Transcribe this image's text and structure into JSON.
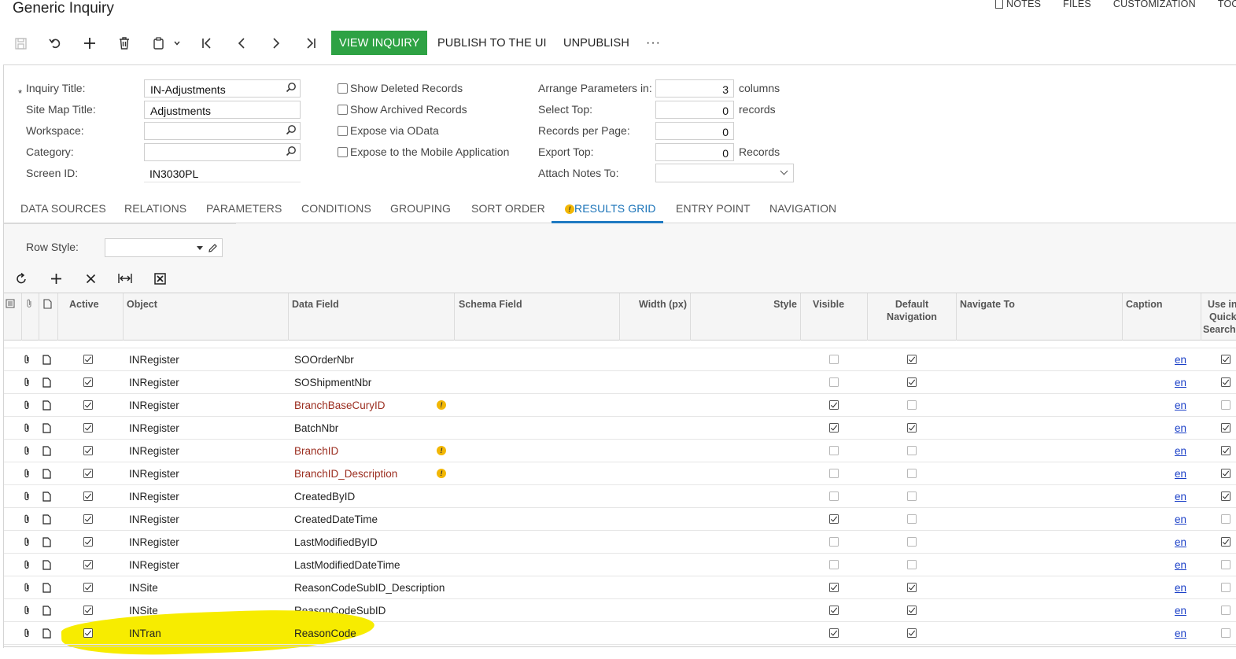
{
  "page": {
    "title": "Generic Inquiry"
  },
  "top_links": {
    "notes": "NOTES",
    "files": "FILES",
    "customization": "CUSTOMIZATION",
    "tools": "TOOLS"
  },
  "toolbar": {
    "view_inquiry": "VIEW INQUIRY",
    "publish": "PUBLISH TO THE UI",
    "unpublish": "UNPUBLISH",
    "more": "···",
    "accent_color": "#2ea244"
  },
  "form": {
    "inquiry_title_label": "Inquiry Title:",
    "inquiry_title_value": "IN-Adjustments",
    "site_map_title_label": "Site Map Title:",
    "site_map_title_value": "Adjustments",
    "workspace_label": "Workspace:",
    "workspace_value": "",
    "category_label": "Category:",
    "category_value": "",
    "screen_id_label": "Screen ID:",
    "screen_id_value": "IN3030PL",
    "show_deleted": "Show Deleted Records",
    "show_archived": "Show Archived Records",
    "expose_odata": "Expose via OData",
    "expose_mobile": "Expose to the Mobile Application",
    "arrange_label": "Arrange Parameters in:",
    "arrange_value": "3",
    "arrange_unit": "columns",
    "select_top_label": "Select Top:",
    "select_top_value": "0",
    "select_top_unit": "records",
    "records_per_page_label": "Records per Page:",
    "records_per_page_value": "0",
    "export_top_label": "Export Top:",
    "export_top_value": "0",
    "export_top_unit": "Records",
    "attach_notes_label": "Attach Notes To:",
    "attach_notes_value": ""
  },
  "tabs": [
    "DATA SOURCES",
    "RELATIONS",
    "PARAMETERS",
    "CONDITIONS",
    "GROUPING",
    "SORT ORDER",
    "RESULTS GRID",
    "ENTRY POINT",
    "NAVIGATION"
  ],
  "active_tab": "RESULTS GRID",
  "row_style": {
    "label": "Row Style:",
    "value": ""
  },
  "grid": {
    "columns": {
      "active": "Active",
      "object": "Object",
      "data_field": "Data Field",
      "schema_field": "Schema Field",
      "width": "Width (px)",
      "style": "Style",
      "visible": "Visible",
      "default_nav_1": "Default",
      "default_nav_2": "Navigation",
      "navigate_to": "Navigate To",
      "caption": "Caption",
      "quick_1": "Use in",
      "quick_2": "Quick",
      "quick_3": "Search"
    },
    "rows": [
      {
        "object": "INRegister",
        "field": "SOOrderNbr",
        "warn": false,
        "visible": false,
        "defnav": true,
        "caption": "en",
        "quick": true
      },
      {
        "object": "INRegister",
        "field": "SOShipmentNbr",
        "warn": false,
        "visible": false,
        "defnav": true,
        "caption": "en",
        "quick": true
      },
      {
        "object": "INRegister",
        "field": "BranchBaseCuryID",
        "warn": true,
        "visible": true,
        "defnav": false,
        "caption": "en",
        "quick": false
      },
      {
        "object": "INRegister",
        "field": "BatchNbr",
        "warn": false,
        "visible": true,
        "defnav": true,
        "caption": "en",
        "quick": true
      },
      {
        "object": "INRegister",
        "field": "BranchID",
        "warn": true,
        "visible": false,
        "defnav": false,
        "caption": "en",
        "quick": true
      },
      {
        "object": "INRegister",
        "field": "BranchID_Description",
        "warn": true,
        "visible": false,
        "defnav": false,
        "caption": "en",
        "quick": true
      },
      {
        "object": "INRegister",
        "field": "CreatedByID",
        "warn": false,
        "visible": false,
        "defnav": false,
        "caption": "en",
        "quick": true
      },
      {
        "object": "INRegister",
        "field": "CreatedDateTime",
        "warn": false,
        "visible": true,
        "defnav": false,
        "caption": "en",
        "quick": false
      },
      {
        "object": "INRegister",
        "field": "LastModifiedByID",
        "warn": false,
        "visible": false,
        "defnav": false,
        "caption": "en",
        "quick": true
      },
      {
        "object": "INRegister",
        "field": "LastModifiedDateTime",
        "warn": false,
        "visible": false,
        "defnav": false,
        "caption": "en",
        "quick": false
      },
      {
        "object": "INSite",
        "field": "ReasonCodeSubID_Description",
        "warn": false,
        "visible": true,
        "defnav": true,
        "caption": "en",
        "quick": false
      },
      {
        "object": "INSite",
        "field": "ReasonCodeSubID",
        "warn": false,
        "visible": true,
        "defnav": true,
        "caption": "en",
        "quick": false
      },
      {
        "object": "INTran",
        "field": "ReasonCode",
        "warn": false,
        "visible": true,
        "defnav": true,
        "caption": "en",
        "quick": false
      }
    ]
  }
}
